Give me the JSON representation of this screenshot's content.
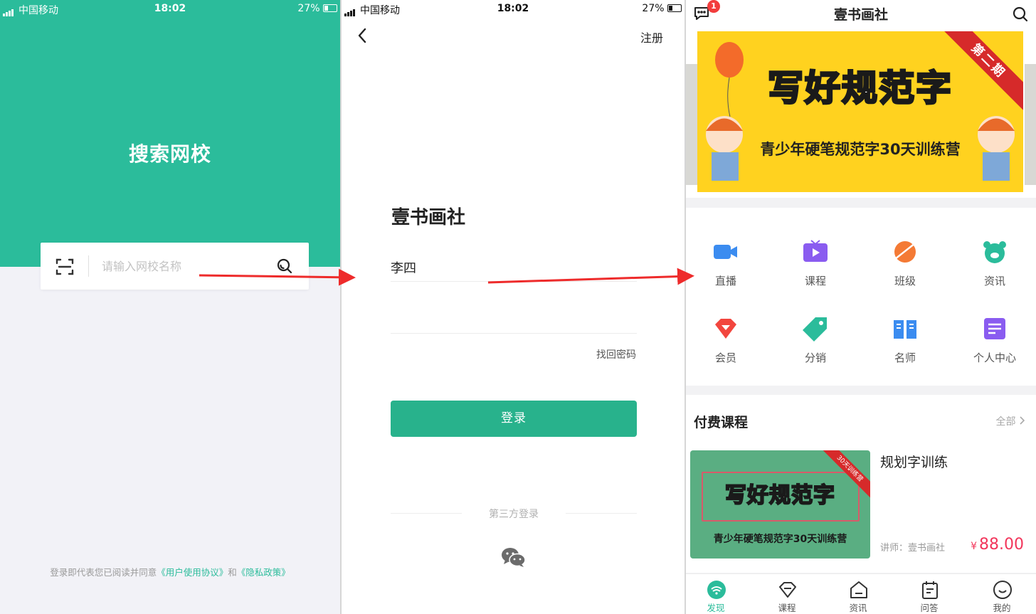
{
  "status_bar": {
    "carrier": "中国移动",
    "time": "18:02",
    "battery": "27%"
  },
  "search_screen": {
    "title": "搜索网校",
    "search": {
      "placeholder": "请输入网校名称"
    },
    "agreement": {
      "prefix": "登录即代表您已阅读并同意",
      "terms": "《用户使用协议》",
      "and": "和",
      "privacy": "《隐私政策》"
    },
    "colors": {
      "primary": "#2bbc9b"
    }
  },
  "login_screen": {
    "register_label": "注册",
    "title": "壹书画社",
    "username_value": "李四",
    "password_value": "",
    "forgot_password": "找回密码",
    "login_button": "登录",
    "third_party_label": "第三方登录",
    "wechat_icon": "wechat-icon",
    "colors": {
      "button": "#28b28c"
    }
  },
  "home_screen": {
    "title": "壹书画社",
    "message_badge": "1",
    "banner": {
      "title": "写好规范字",
      "subtitle": "青少年硬笔规范字30天训练营",
      "ribbon": "第二期"
    },
    "menu": [
      {
        "label": "直播",
        "icon": "video-camera-icon",
        "color": "#3b8cf0"
      },
      {
        "label": "课程",
        "icon": "tv-play-icon",
        "color": "#8a5cf0"
      },
      {
        "label": "班级",
        "icon": "planet-icon",
        "color": "#f47a35"
      },
      {
        "label": "资讯",
        "icon": "news-bear-icon",
        "color": "#2bbc9b"
      },
      {
        "label": "会员",
        "icon": "diamond-icon",
        "color": "#f2463e"
      },
      {
        "label": "分销",
        "icon": "tag-icon",
        "color": "#2bbc9b"
      },
      {
        "label": "名师",
        "icon": "book-icon",
        "color": "#3b8cf0"
      },
      {
        "label": "个人中心",
        "icon": "profile-card-icon",
        "color": "#8a5cf0"
      }
    ],
    "paid_courses": {
      "title": "付费课程",
      "view_all": "全部",
      "items": [
        {
          "name": "规划字训练",
          "image_title": "写好规范字",
          "image_subtitle": "青少年硬笔规范字30天训练营",
          "image_ribbon": "30天训练营",
          "teacher": "讲师：壹书画社",
          "currency": "¥",
          "price": "88.00"
        }
      ]
    },
    "tabs": [
      {
        "label": "发现",
        "icon": "discover-icon",
        "active": true
      },
      {
        "label": "课程",
        "icon": "course-diamond-icon",
        "active": false
      },
      {
        "label": "资讯",
        "icon": "news-home-icon",
        "active": false
      },
      {
        "label": "问答",
        "icon": "qa-calendar-icon",
        "active": false
      },
      {
        "label": "我的",
        "icon": "profile-smile-icon",
        "active": false
      }
    ],
    "colors": {
      "accent": "#2bbc9b",
      "price": "#f2365b"
    }
  }
}
